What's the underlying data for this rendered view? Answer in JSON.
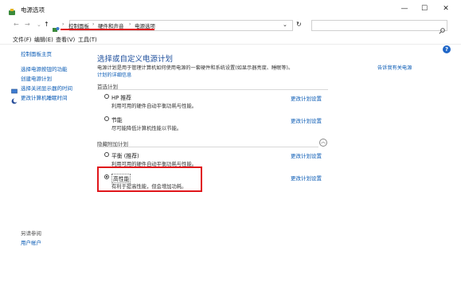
{
  "window": {
    "title": "电源选项",
    "minimize": "—",
    "maximize": "☐",
    "close": "✕"
  },
  "nav": {
    "back": "←",
    "forward": "→",
    "up": "↑",
    "breadcrumb": [
      "控制面板",
      "硬件和声音",
      "电源选项"
    ],
    "dropdown": "⌄",
    "refresh": "↻",
    "search_placeholder": ""
  },
  "menu": [
    {
      "label": "文件(F)"
    },
    {
      "label": "编辑(E)"
    },
    {
      "label": "查看(V)"
    },
    {
      "label": "工具(T)"
    }
  ],
  "sidebar": {
    "home": "控制面板主页",
    "items": [
      "选择电源按钮的功能",
      "创建电源计划",
      "选择关闭显示器的时间",
      "更改计算机睡眠时间"
    ],
    "see_also_heading": "另请参阅",
    "see_also": [
      "用户帐户"
    ]
  },
  "main": {
    "heading": "选择或自定义电源计划",
    "description_line1": "电源计划是用于管理计算机如何使用电源的一套硬件和系统设置(如显示器亮度、睡眠等)。",
    "description_link1": "告诉我有关电源",
    "description_link2": "计划的详细信息",
    "preferred_heading": "首选计划",
    "hidden_heading": "隐藏附加计划",
    "help": "?",
    "plans": [
      {
        "name": "HP 推荐",
        "desc": "利用可用的硬件自动平衡功耗与性能。",
        "change": "更改计划设置",
        "selected": false
      },
      {
        "name": "节能",
        "desc": "尽可能降低计算机性能以节能。",
        "change": "更改计划设置",
        "selected": false
      },
      {
        "name": "平衡 (推荐)",
        "desc": "利用可用的硬件自动平衡功耗与性能。",
        "change": "更改计划设置",
        "selected": false
      },
      {
        "name": "高性能",
        "desc": "有利于提高性能，但会增加功耗。",
        "change": "更改计划设置",
        "selected": true
      }
    ]
  },
  "colors": {
    "annotation_red": "#e0161b",
    "link_blue": "#0a5bb5"
  }
}
